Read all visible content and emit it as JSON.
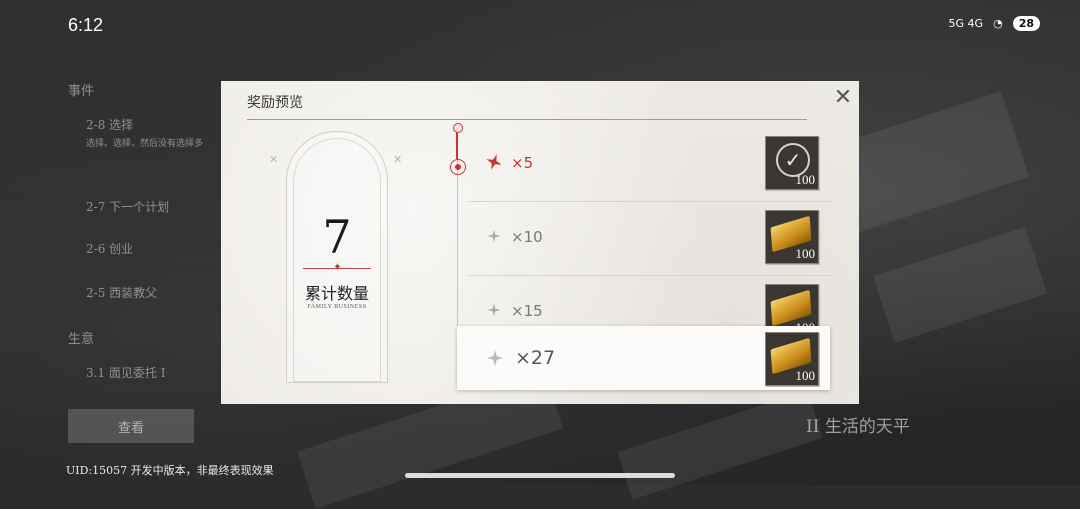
{
  "status_bar": {
    "time": "6:12",
    "network": "5G 4G",
    "battery": "28"
  },
  "background": {
    "menu": {
      "section1": "事件",
      "item1": "2-8 选择",
      "item1_desc": "选择。选择，然后没有选择多",
      "item2": "2-7 下一个计划",
      "item3": "2-6 创业",
      "item4": "2-5 西装教父",
      "section2": "生意",
      "item5": "3.1 面见委托 I"
    },
    "button_label": "查看",
    "chapter_label": "II 生活的天平",
    "uid_text": "UID:15057  开发中版本，非最终表现效果"
  },
  "dialog": {
    "title": "奖励预览",
    "count": "7",
    "count_label": "累计数量",
    "count_sub": "FAMILY BUSINESS",
    "rows": [
      {
        "amount": "×5",
        "reward_icon": "ticket-check-icon",
        "reward_qty": "100"
      },
      {
        "amount": "×10",
        "reward_icon": "gold-bar-icon",
        "reward_qty": "100"
      },
      {
        "amount": "×15",
        "reward_icon": "gold-bar-icon",
        "reward_qty": "100"
      }
    ],
    "highlight": {
      "amount": "×27",
      "reward_icon": "gold-bar-icon",
      "reward_qty": "100"
    }
  },
  "colors": {
    "accent": "#c0392b",
    "panel": "#eeebe6"
  }
}
